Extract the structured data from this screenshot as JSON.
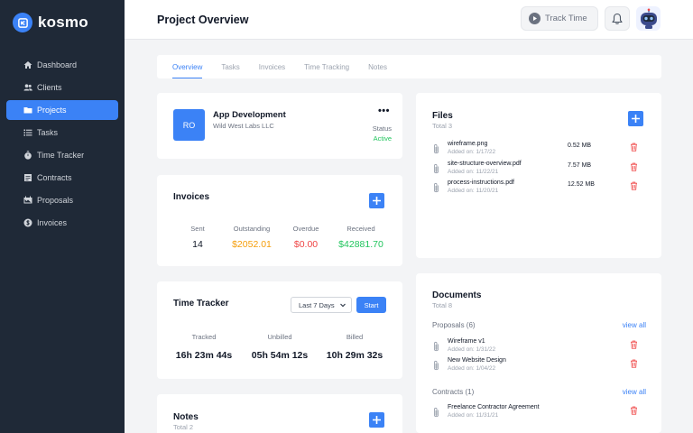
{
  "brand": {
    "name": "kosmo",
    "accent": "#3b82f6"
  },
  "sidebar": {
    "items": [
      {
        "label": "Dashboard",
        "icon": "home-icon",
        "active": false
      },
      {
        "label": "Clients",
        "icon": "users-icon",
        "active": false
      },
      {
        "label": "Projects",
        "icon": "folder-icon",
        "active": true
      },
      {
        "label": "Tasks",
        "icon": "list-icon",
        "active": false
      },
      {
        "label": "Time Tracker",
        "icon": "stopwatch-icon",
        "active": false
      },
      {
        "label": "Contracts",
        "icon": "contract-icon",
        "active": false
      },
      {
        "label": "Proposals",
        "icon": "proposal-icon",
        "active": false
      },
      {
        "label": "Invoices",
        "icon": "dollar-icon",
        "active": false
      }
    ]
  },
  "header": {
    "title": "Project Overview",
    "track_time_label": "Track Time"
  },
  "tabs": [
    {
      "label": "Overview",
      "active": true
    },
    {
      "label": "Tasks",
      "active": false
    },
    {
      "label": "Invoices",
      "active": false
    },
    {
      "label": "Time Tracking",
      "active": false
    },
    {
      "label": "Notes",
      "active": false
    }
  ],
  "project": {
    "initials": "RO",
    "name": "App Development",
    "client": "Wild West Labs LLC",
    "status_label": "Status",
    "status_value": "Active",
    "status_color": "#22c55e"
  },
  "invoices": {
    "title": "Invoices",
    "stats": [
      {
        "label": "Sent",
        "value": "14",
        "color": "#111827"
      },
      {
        "label": "Outstanding",
        "value": "$2052.01",
        "color": "#f59e0b"
      },
      {
        "label": "Overdue",
        "value": "$0.00",
        "color": "#ef4444"
      },
      {
        "label": "Received",
        "value": "$42881.70",
        "color": "#22c55e"
      }
    ]
  },
  "time_tracker": {
    "title": "Time Tracker",
    "range_selected": "Last 7 Days",
    "start_label": "Start",
    "stats": [
      {
        "label": "Tracked",
        "value": "16h 23m 44s"
      },
      {
        "label": "Unbilled",
        "value": "05h 54m 12s"
      },
      {
        "label": "Billed",
        "value": "10h 29m 32s"
      }
    ]
  },
  "notes": {
    "title": "Notes",
    "total": "Total 2"
  },
  "files": {
    "title": "Files",
    "total": "Total 3",
    "items": [
      {
        "name": "wireframe.png",
        "added": "Added on: 1/17/22",
        "size": "0.52 MB"
      },
      {
        "name": "site-structure-overview.pdf",
        "added": "Added on: 11/22/21",
        "size": "7.57 MB"
      },
      {
        "name": "process-instructions.pdf",
        "added": "Added on: 11/20/21",
        "size": "12.52 MB"
      }
    ]
  },
  "documents": {
    "title": "Documents",
    "total": "Total 8",
    "view_all": "view all",
    "proposals_label": "Proposals (6)",
    "proposals": [
      {
        "name": "Wireframe v1",
        "added": "Added on: 1/31/22"
      },
      {
        "name": "New Website Design",
        "added": "Added on: 1/04/22"
      }
    ],
    "contracts_label": "Contracts (1)",
    "contracts": [
      {
        "name": "Freelance Contractor Agreement",
        "added": "Added on: 11/31/21"
      }
    ]
  }
}
